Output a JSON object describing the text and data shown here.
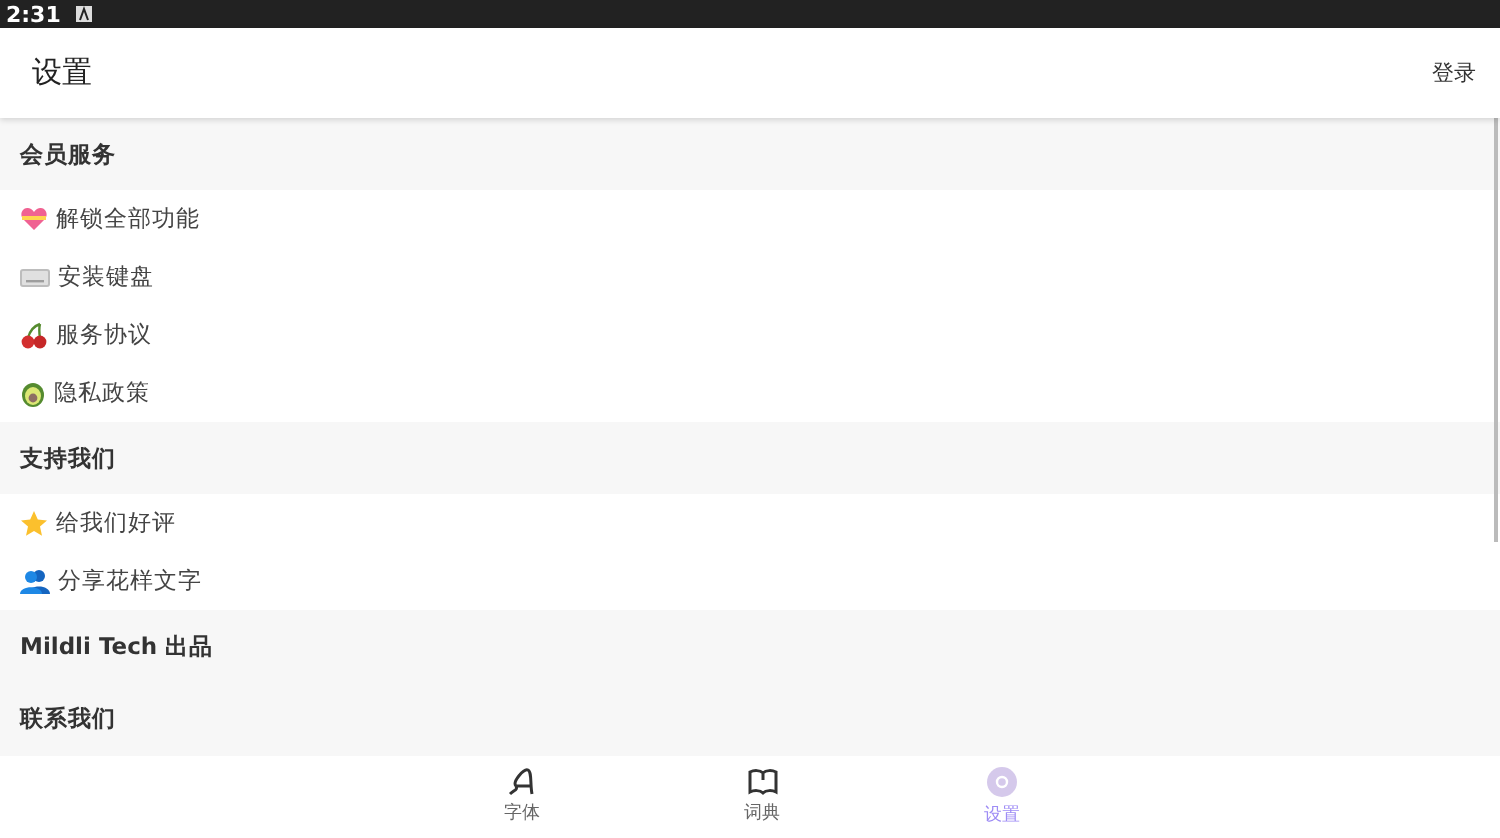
{
  "status_bar": {
    "time": "2:31"
  },
  "app_bar": {
    "title": "设置",
    "action": "登录"
  },
  "sections": [
    {
      "title": "会员服务",
      "items": [
        {
          "label": "解锁全部功能"
        },
        {
          "label": "安装键盘"
        },
        {
          "label": "服务协议"
        },
        {
          "label": "隐私政策"
        }
      ]
    },
    {
      "title": "支持我们",
      "items": [
        {
          "label": "给我们好评"
        },
        {
          "label": "分享花样文字"
        }
      ]
    },
    {
      "title": "Mildli Tech 出品"
    },
    {
      "title": "联系我们"
    }
  ],
  "bottom_nav": [
    {
      "label": "字体",
      "selected": false
    },
    {
      "label": "词典",
      "selected": false
    },
    {
      "label": "设置",
      "selected": true
    }
  ]
}
